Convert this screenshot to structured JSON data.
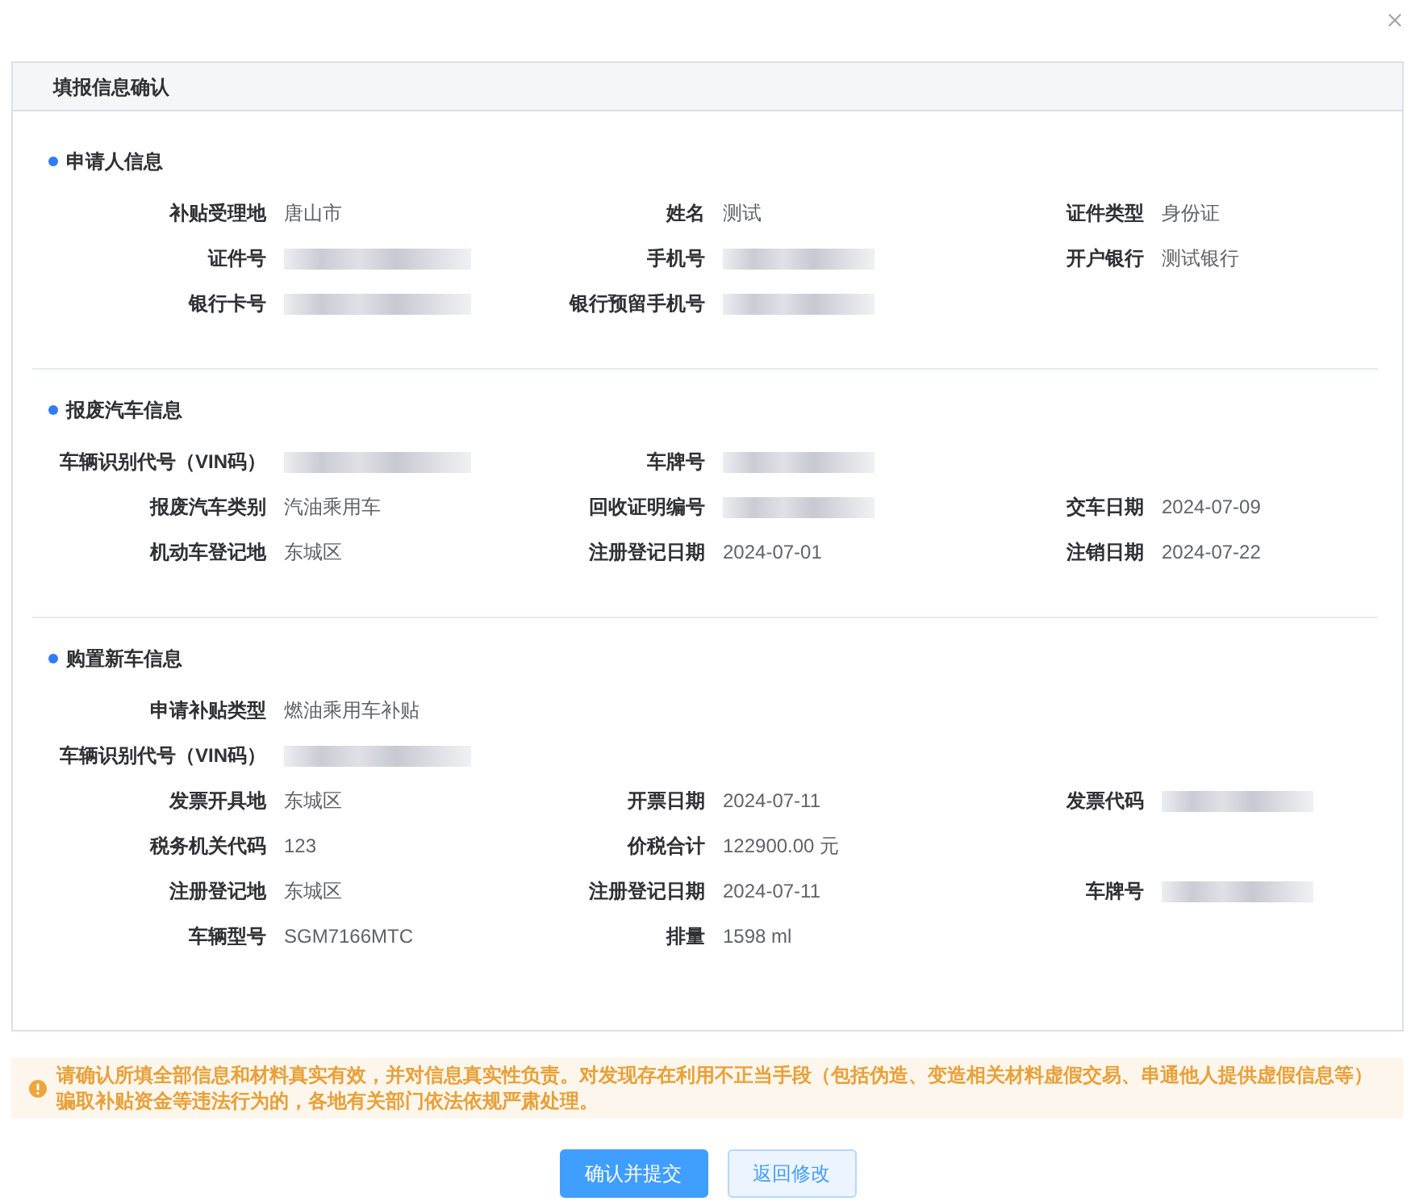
{
  "panel": {
    "title": "填报信息确认"
  },
  "sections": [
    {
      "title": "申请人信息",
      "rows": [
        [
          {
            "label": "补贴受理地",
            "value": "唐山市",
            "redacted": false
          },
          {
            "label": "姓名",
            "value": "测试",
            "redacted": false
          },
          {
            "label": "证件类型",
            "value": "身份证",
            "redacted": false
          }
        ],
        [
          {
            "label": "证件号",
            "redacted": true
          },
          {
            "label": "手机号",
            "redacted": true
          },
          {
            "label": "开户银行",
            "value": "测试银行",
            "redacted": false
          }
        ],
        [
          {
            "label": "银行卡号",
            "redacted": true
          },
          {
            "label": "银行预留手机号",
            "redacted": true
          }
        ]
      ]
    },
    {
      "title": "报废汽车信息",
      "rows": [
        [
          {
            "label": "车辆识别代号（VIN码）",
            "redacted": true
          },
          {
            "label": "车牌号",
            "redacted": true
          }
        ],
        [
          {
            "label": "报废汽车类别",
            "value": "汽油乘用车",
            "redacted": false
          },
          {
            "label": "回收证明编号",
            "redacted": true
          },
          {
            "label": "交车日期",
            "value": "2024-07-09",
            "redacted": false
          }
        ],
        [
          {
            "label": "机动车登记地",
            "value": "东城区",
            "redacted": false
          },
          {
            "label": "注册登记日期",
            "value": "2024-07-01",
            "redacted": false
          },
          {
            "label": "注销日期",
            "value": "2024-07-22",
            "redacted": false
          }
        ]
      ]
    },
    {
      "title": "购置新车信息",
      "rows": [
        [
          {
            "label": "申请补贴类型",
            "value": "燃油乘用车补贴",
            "redacted": false
          }
        ],
        [
          {
            "label": "车辆识别代号（VIN码）",
            "redacted": true
          }
        ],
        [
          {
            "label": "发票开具地",
            "value": "东城区",
            "redacted": false
          },
          {
            "label": "开票日期",
            "value": "2024-07-11",
            "redacted": false
          },
          {
            "label": "发票代码",
            "redacted": true
          }
        ],
        [
          {
            "label": "税务机关代码",
            "value": "123",
            "redacted": false
          },
          {
            "label": "价税合计",
            "value": "122900.00 元",
            "redacted": false
          }
        ],
        [
          {
            "label": "注册登记地",
            "value": "东城区",
            "redacted": false
          },
          {
            "label": "注册登记日期",
            "value": "2024-07-11",
            "redacted": false
          },
          {
            "label": "车牌号",
            "redacted": true
          }
        ],
        [
          {
            "label": "车辆型号",
            "value": "SGM7166MTC",
            "redacted": false
          },
          {
            "label": "排量",
            "value": "1598 ml",
            "redacted": false
          }
        ]
      ]
    }
  ],
  "notice": {
    "text": "请确认所填全部信息和材料真实有效，并对信息真实性负责。对发现存在利用不正当手段（包括伪造、变造相关材料虚假交易、串通他人提供虚假信息等）骗取补贴资金等违法行为的，各地有关部门依法依规严肃处理。"
  },
  "buttons": [
    {
      "label": "确认并提交",
      "kind": "primary"
    },
    {
      "label": "返回修改",
      "kind": "secondary"
    }
  ]
}
